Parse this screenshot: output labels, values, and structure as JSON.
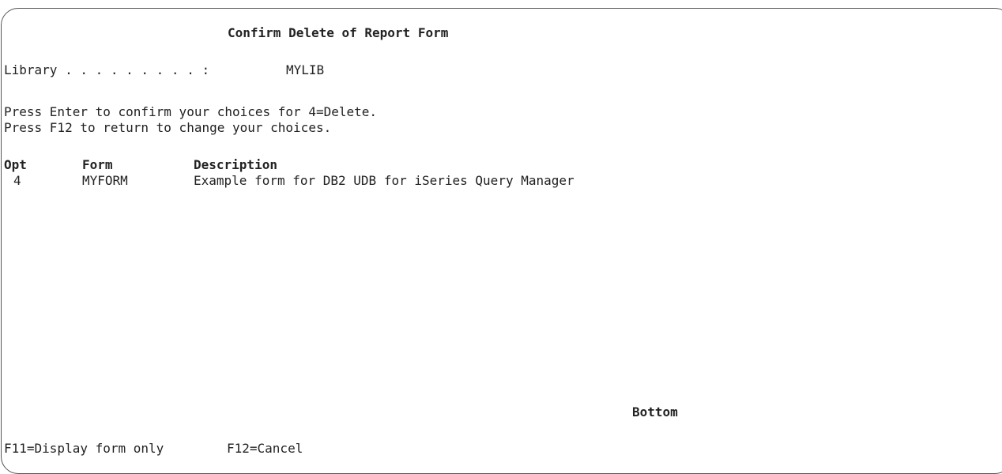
{
  "screen": {
    "title": "Confirm Delete of Report Form",
    "library_label": "Library . . . . . . . . . :",
    "library_value": "MYLIB",
    "instructions": [
      "Press Enter to confirm your choices for 4=Delete.",
      "Press F12 to return to change your choices."
    ]
  },
  "table": {
    "columns": {
      "opt": "Opt",
      "form": "Form",
      "description": "Description"
    },
    "rows": [
      {
        "opt": "4",
        "form": "MYFORM",
        "description": "Example form for DB2 UDB for iSeries Query Manager"
      }
    ]
  },
  "status": {
    "scroll_indicator": "Bottom"
  },
  "function_keys": [
    "F11=Display form only",
    "F12=Cancel"
  ]
}
